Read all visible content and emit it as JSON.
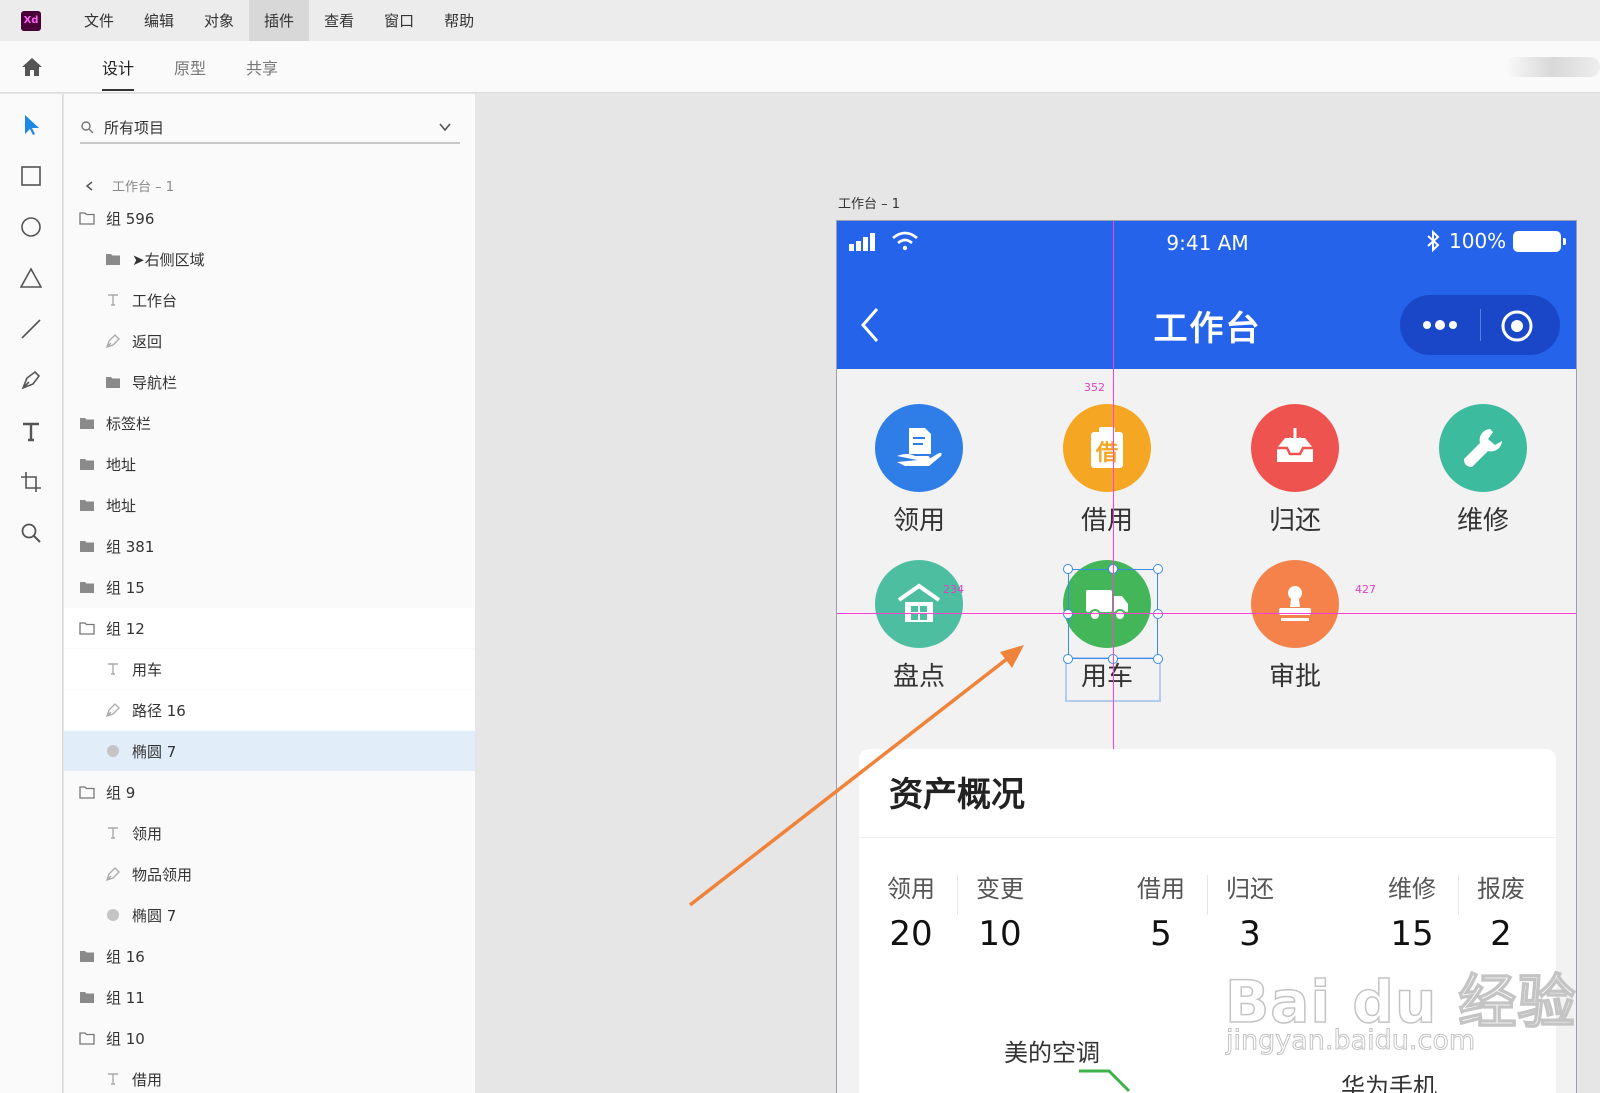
{
  "menubar": {
    "logo": "Xd",
    "items": [
      "文件",
      "编辑",
      "对象",
      "插件",
      "查看",
      "窗口",
      "帮助"
    ],
    "active_index": 3
  },
  "modebar": {
    "tabs": [
      "设计",
      "原型",
      "共享"
    ],
    "active_index": 0
  },
  "tools": [
    "select-tool",
    "rectangle-tool",
    "ellipse-tool",
    "polygon-tool",
    "line-tool",
    "pen-tool",
    "text-tool",
    "artboard-tool",
    "zoom-tool"
  ],
  "layers": {
    "search_label": "所有项目",
    "breadcrumb": "工作台 – 1",
    "rows": [
      {
        "label": "组 596",
        "icon": "folder-open-icon",
        "indent": 0
      },
      {
        "label": "➤右侧区域",
        "icon": "folder-icon",
        "indent": 1
      },
      {
        "label": "工作台",
        "icon": "text-layer-icon",
        "indent": 1
      },
      {
        "label": "返回",
        "icon": "path-icon",
        "indent": 1
      },
      {
        "label": "导航栏",
        "icon": "folder-icon",
        "indent": 1
      },
      {
        "label": "标签栏",
        "icon": "folder-icon",
        "indent": 0
      },
      {
        "label": "地址",
        "icon": "folder-icon",
        "indent": 0
      },
      {
        "label": "地址",
        "icon": "folder-icon",
        "indent": 0
      },
      {
        "label": "组 381",
        "icon": "folder-icon",
        "indent": 0
      },
      {
        "label": "组 15",
        "icon": "folder-icon",
        "indent": 0
      },
      {
        "label": "组 12",
        "icon": "folder-open-icon",
        "indent": 0,
        "state": "hl"
      },
      {
        "label": "用车",
        "icon": "text-layer-icon",
        "indent": 1,
        "state": "hl"
      },
      {
        "label": "路径 16",
        "icon": "path-icon",
        "indent": 1,
        "state": "hl"
      },
      {
        "label": "椭圆 7",
        "icon": "ellipse-layer-icon",
        "indent": 1,
        "state": "sel"
      },
      {
        "label": "组 9",
        "icon": "folder-open-icon",
        "indent": 0
      },
      {
        "label": "领用",
        "icon": "text-layer-icon",
        "indent": 1
      },
      {
        "label": "物品领用",
        "icon": "path-icon",
        "indent": 1
      },
      {
        "label": "椭圆 7",
        "icon": "ellipse-layer-icon",
        "indent": 1
      },
      {
        "label": "组 16",
        "icon": "folder-icon",
        "indent": 0
      },
      {
        "label": "组 11",
        "icon": "folder-icon",
        "indent": 0
      },
      {
        "label": "组 10",
        "icon": "folder-open-icon",
        "indent": 0
      },
      {
        "label": "借用",
        "icon": "text-layer-icon",
        "indent": 1
      }
    ]
  },
  "artboard": {
    "title": "工作台 – 1",
    "status_time": "9:41 AM",
    "battery": "100%",
    "nav_title": "工作台",
    "apps": [
      {
        "label": "领用",
        "color": "#2f7de6",
        "icon": "hand-document-icon"
      },
      {
        "label": "借用",
        "color": "#f5a623",
        "icon": "borrow-box-icon",
        "glyph": "借"
      },
      {
        "label": "归还",
        "color": "#ef5350",
        "icon": "return-tray-icon"
      },
      {
        "label": "维修",
        "color": "#3dbb9e",
        "icon": "wrench-icon"
      },
      {
        "label": "盘点",
        "color": "#4dbfa0",
        "icon": "warehouse-icon"
      },
      {
        "label": "用车",
        "color": "#43b65a",
        "icon": "truck-icon"
      },
      {
        "label": "审批",
        "color": "#f5824a",
        "icon": "stamp-icon"
      }
    ],
    "guides": {
      "top": "352",
      "left": "234",
      "right": "427"
    },
    "card": {
      "title": "资产概况",
      "stats": [
        {
          "label": "领用",
          "value": "20"
        },
        {
          "label": "变更",
          "value": "10"
        },
        {
          "label": "借用",
          "value": "5"
        },
        {
          "label": "归还",
          "value": "3"
        },
        {
          "label": "维修",
          "value": "15"
        },
        {
          "label": "报废",
          "value": "2"
        }
      ],
      "chart_labels": [
        "美的空调",
        "华为手机"
      ]
    }
  },
  "colors": {
    "accent": "#2563eb",
    "capsule": "#1a47c7",
    "guide": "#ff3fd8",
    "selection": "#3b8beb",
    "arrow": "#f0833a"
  },
  "watermark": {
    "main": "Bai du 经验",
    "sub": "jingyan.baidu.com"
  }
}
